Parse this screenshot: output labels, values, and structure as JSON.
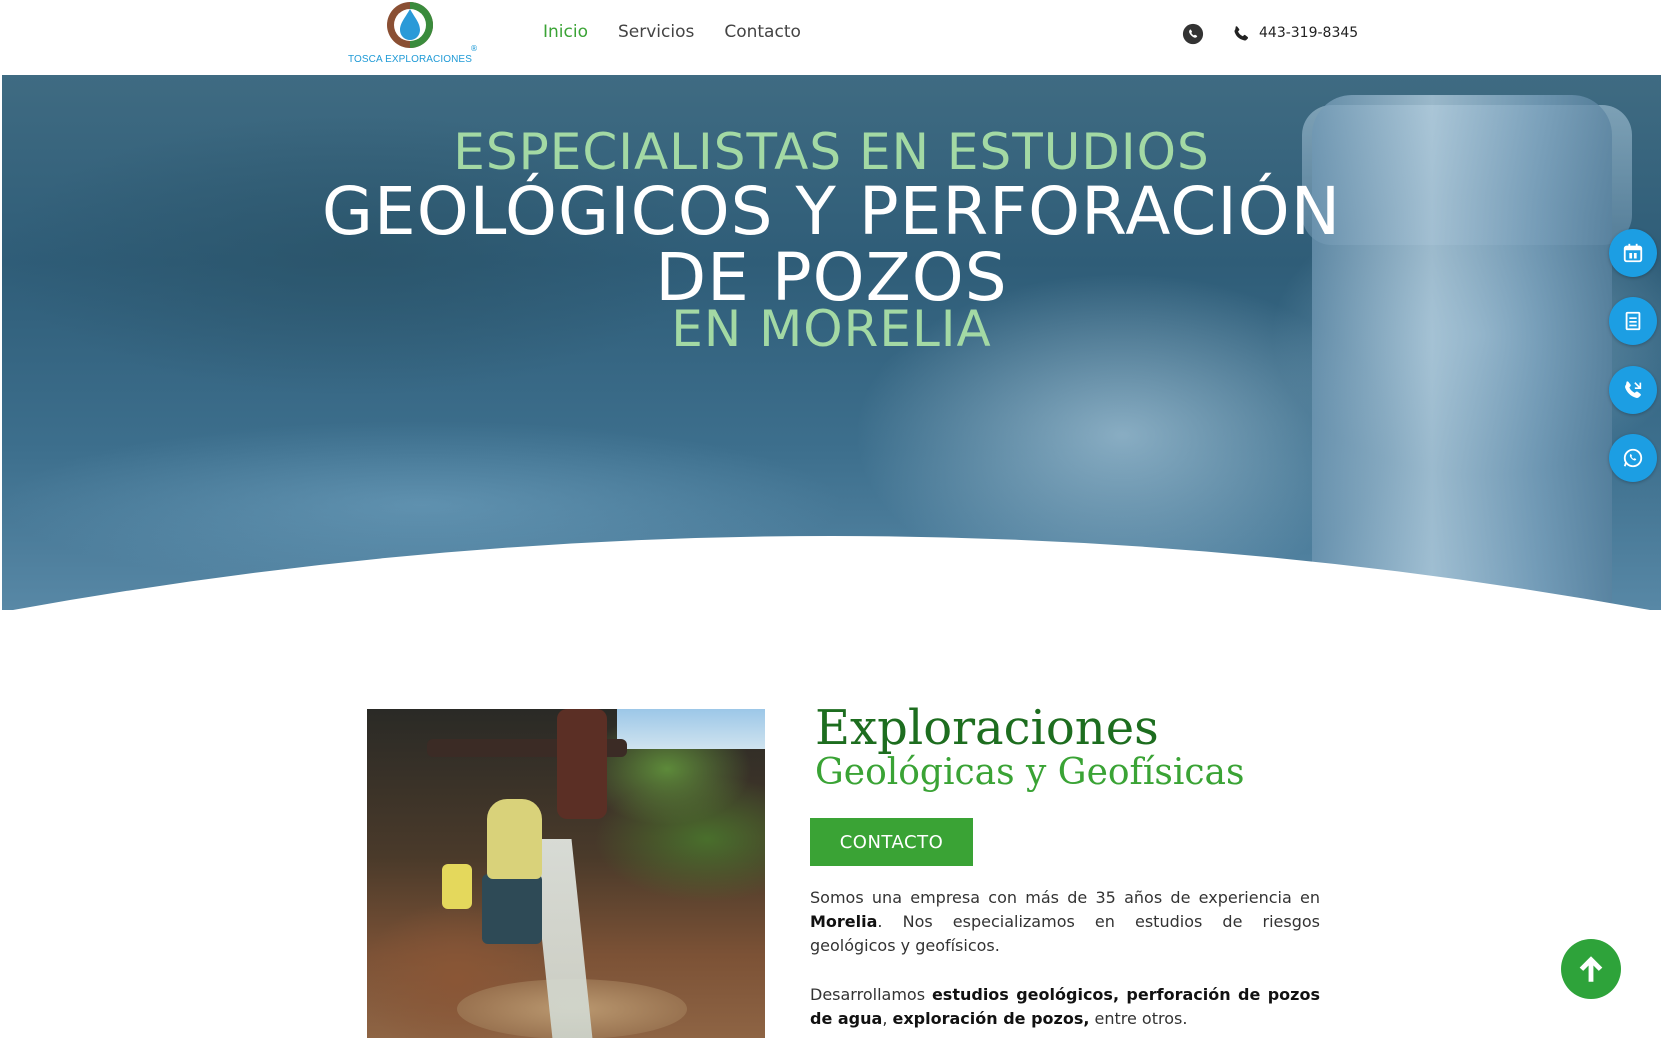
{
  "header": {
    "logo_text": "TOSCA EXPLORACIONES",
    "logo_reg": "®",
    "nav": [
      {
        "label": "Inicio",
        "active": true
      },
      {
        "label": "Servicios",
        "active": false
      },
      {
        "label": "Contacto",
        "active": false
      }
    ],
    "phone": "443-319-8345",
    "icons": [
      "whatsapp-icon",
      "phone-icon"
    ]
  },
  "hero": {
    "line1": "ESPECIALISTAS EN ESTUDIOS",
    "line2": "GEOLÓGICOS Y PERFORACIÓN",
    "line3": "DE POZOS",
    "line4": "EN MORELIA"
  },
  "side_buttons": [
    "calendar-icon",
    "document-icon",
    "phone-call-icon",
    "whatsapp-icon"
  ],
  "content": {
    "title": "Exploraciones",
    "subtitle": "Geológicas y Geofísicas",
    "cta_label": "CONTACTO",
    "p1_a": "Somos una empresa con más de 35 años de experiencia en ",
    "p1_b": "Morelia",
    "p1_c": ". Nos especializamos en estudios de riesgos geológicos y geofísicos.",
    "p2_a": "Desarrollamos ",
    "p2_b": "estudios geológicos, perforación de pozos de agua",
    "p2_c": ", ",
    "p2_d": "exploración de pozos,",
    "p2_e": " entre otros."
  },
  "colors": {
    "accent_green": "#3aa335",
    "title_green": "#1d6d1f",
    "side_blue": "#1c9ee3",
    "hero_blue": "#2f5d78"
  }
}
